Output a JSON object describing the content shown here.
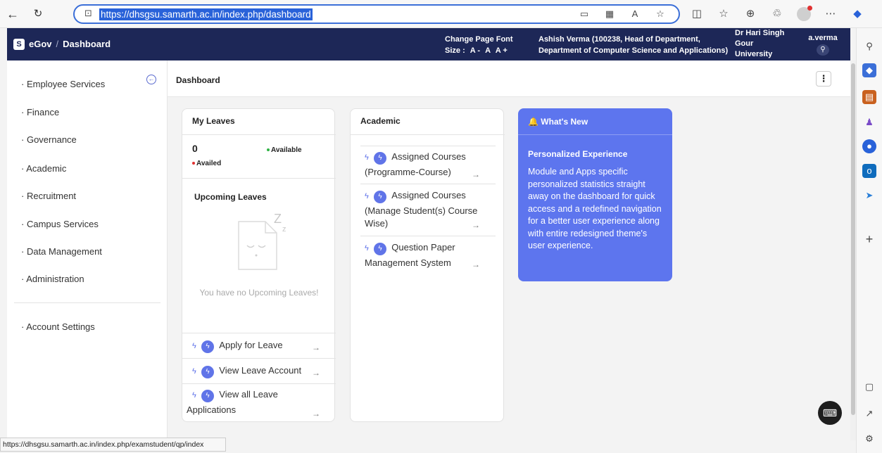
{
  "browser": {
    "url": "https://dhsgsu.samarth.ac.in/index.php/dashboard",
    "back_icon": "←",
    "refresh_icon": "C",
    "lock_icon": "🔒",
    "read_aloud": "A̩",
    "reader_icon": "Aᐟ"
  },
  "header": {
    "logo_letter": "S",
    "brand": "eGov",
    "breadcrumb": "Dashboard",
    "font_label": "Change Page Font",
    "font_size_label": "Size :",
    "font_controls": [
      "A -",
      "A",
      "A +"
    ],
    "user_line1": "Ashish Verma (100238, Head of Department,",
    "user_line2": "Department of Computer Science and Applications)",
    "university": "Dr Hari Singh Gour University",
    "username": "a.verma"
  },
  "sidebar": {
    "items": [
      "Employee Services",
      "Finance",
      "Governance",
      "Academic",
      "Recruitment",
      "Campus Services",
      "Data Management",
      "Administration"
    ],
    "account_settings": "Account Settings"
  },
  "page": {
    "title": "Dashboard"
  },
  "leaves": {
    "title": "My Leaves",
    "count": "0",
    "available": "Available",
    "availed": "Availed",
    "upcoming_title": "Upcoming Leaves",
    "empty_msg": "You have no Upcoming Leaves!",
    "links": [
      "Apply for Leave",
      "View Leave Account",
      "View all Leave Applications"
    ],
    "link3_line1": "View all Leave",
    "link3_line2": "Applications"
  },
  "academic": {
    "title": "Academic",
    "link1_line1": "Assigned Courses",
    "link1_line2": "(Programme-Course)",
    "link2_line1": "Assigned Courses",
    "link2_line2": "(Manage Student(s) Course",
    "link2_line3": "Wise)",
    "link3_line1": "Question Paper",
    "link3_line2": "Management System"
  },
  "whats_new": {
    "title": "What's New",
    "heading": "Personalized Experience",
    "body": "Module and Apps specific personalized statistics straight away on the dashboard for quick access and a redefined navigation for a better user experience along with entire redesigned theme's user experience."
  },
  "status_bar": {
    "url": "https://dhsgsu.samarth.ac.in/index.php/examstudent/qp/index"
  },
  "colors": {
    "header_bg": "#1d2757",
    "accent": "#5d75ee",
    "available_dot": "#2fb344",
    "availed_dot": "#e03131"
  }
}
